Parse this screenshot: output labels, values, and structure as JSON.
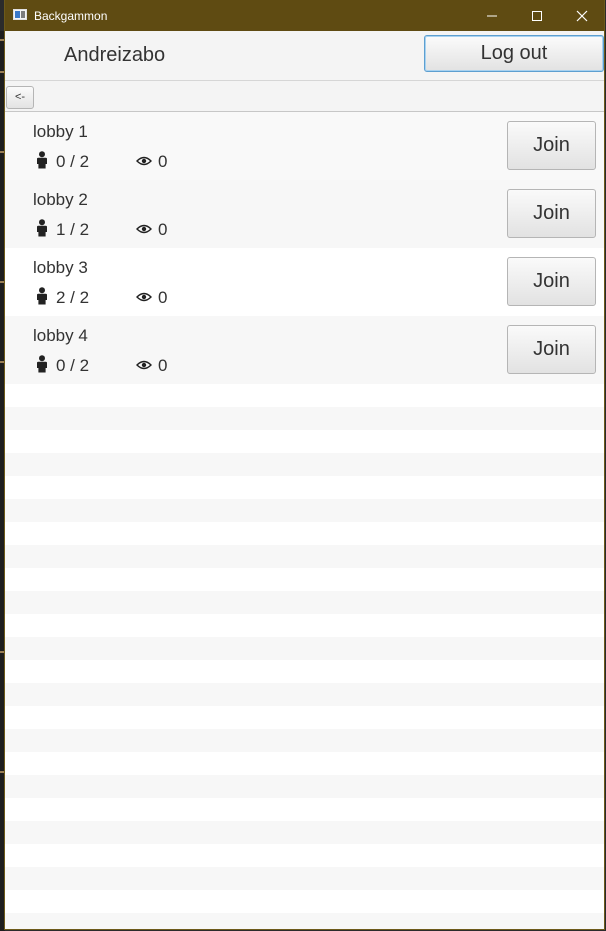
{
  "window": {
    "title": "Backgammon"
  },
  "header": {
    "username": "Andreizabo",
    "logout_label": "Log out"
  },
  "toolbar": {
    "back_label": "<-"
  },
  "lobbies": [
    {
      "name": "lobby 1",
      "players": "0 / 2",
      "watchers": "0",
      "join_label": "Join"
    },
    {
      "name": "lobby 2",
      "players": "1 / 2",
      "watchers": "0",
      "join_label": "Join"
    },
    {
      "name": "lobby 3",
      "players": "2 / 2",
      "watchers": "0",
      "join_label": "Join"
    },
    {
      "name": "lobby 4",
      "players": "0 / 2",
      "watchers": "0",
      "join_label": "Join"
    }
  ],
  "icons": {
    "players": "person-icon",
    "watchers": "eye-icon"
  },
  "colors": {
    "titlebar": "#5f4b12",
    "logout_border": "#5d9fd0"
  }
}
